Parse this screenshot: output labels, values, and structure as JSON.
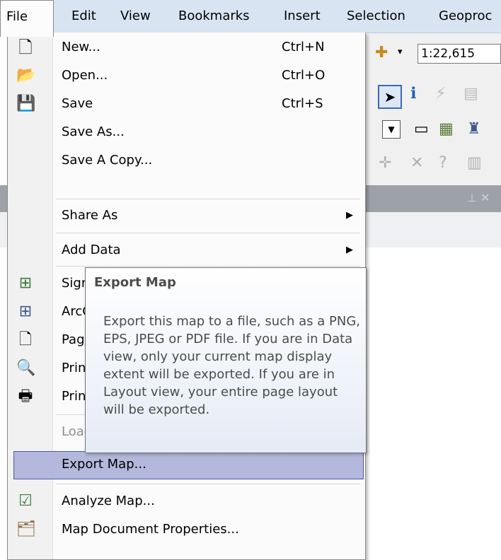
{
  "menubar": {
    "items": [
      "File",
      "Edit",
      "View",
      "Bookmarks",
      "Insert",
      "Selection",
      "Geoproc"
    ]
  },
  "toolbar": {
    "scale_value": "1:22,615"
  },
  "file_menu": {
    "items": [
      {
        "label": "New...",
        "shortcut": "Ctrl+N",
        "icon": "new-document-icon"
      },
      {
        "label": "Open...",
        "shortcut": "Ctrl+O",
        "icon": "open-folder-icon"
      },
      {
        "label": "Save",
        "shortcut": "Ctrl+S",
        "icon": "save-disk-icon"
      },
      {
        "label": "Save As...",
        "shortcut": ""
      },
      {
        "label": "Save A Copy...",
        "shortcut": ""
      },
      {
        "label": "Share As",
        "submenu": true
      },
      {
        "label": "Add Data",
        "submenu": true
      },
      {
        "label": "Sign In...",
        "icon": "sign-in-icon"
      },
      {
        "label": "ArcGIS Online...",
        "icon": "arcgis-online-icon"
      },
      {
        "label": "Page and Print Setup...",
        "icon": "page-setup-icon"
      },
      {
        "label": "Print Preview...",
        "icon": "print-preview-icon"
      },
      {
        "label": "Print...",
        "icon": "printer-icon"
      },
      {
        "label": "Load Map...",
        "disabled": true
      },
      {
        "label": "Export Map...",
        "highlighted": true
      },
      {
        "label": "Analyze Map...",
        "icon": "analyze-map-icon"
      },
      {
        "label": "Map Document Properties...",
        "icon": "map-properties-icon"
      }
    ]
  },
  "tooltip": {
    "title": "Export Map",
    "body": "Export this map to a file, such as a PNG, EPS, JPEG or PDF file. If you are in Data view, only your current map display extent will be exported. If you are in Layout view, your entire page layout will be exported."
  }
}
